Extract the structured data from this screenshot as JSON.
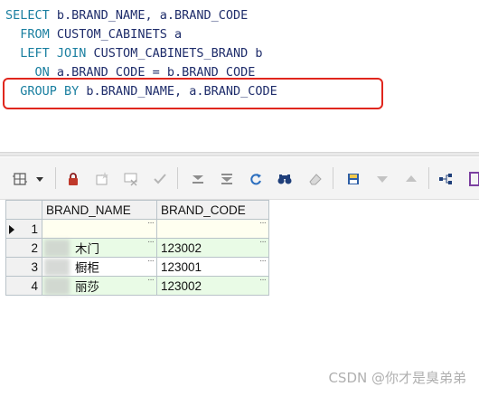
{
  "editor": {
    "lines": [
      {
        "kw1": "SELECT",
        "text": " b.BRAND_NAME, a.BRAND_CODE",
        "indent": ""
      },
      {
        "kw1": "FROM",
        "text": " CUSTOM_CABINETS a",
        "indent": "  "
      },
      {
        "kw1": "LEFT JOIN",
        "text": " CUSTOM_CABINETS_BRAND b",
        "indent": "  "
      },
      {
        "kw1": "ON",
        "text": " a.BRAND_CODE = b.BRAND_CODE",
        "indent": "    "
      },
      {
        "kw1": "GROUP BY",
        "text": " b.BRAND_NAME, a.BRAND_CODE",
        "indent": "  "
      }
    ]
  },
  "toolbar": {
    "icons": [
      "grid-options-icon",
      "dropdown-arrow-icon",
      "lock-icon",
      "new-record-icon",
      "delete-record-icon",
      "post-check-icon",
      "filter-first-icon",
      "filter-last-icon",
      "refresh-icon",
      "find-icon",
      "clear-icon",
      "save-icon",
      "sort-down-icon",
      "sort-up-icon",
      "tree-icon",
      "export-icon"
    ]
  },
  "grid": {
    "columns": [
      "BRAND_NAME",
      "BRAND_CODE"
    ],
    "rows": [
      {
        "num": "1",
        "brand_name": "",
        "brand_code": ""
      },
      {
        "num": "2",
        "brand_name": "木门",
        "brand_code": "123002"
      },
      {
        "num": "3",
        "brand_name": "橱柜",
        "brand_code": "123001"
      },
      {
        "num": "4",
        "brand_name": "丽莎",
        "brand_code": "123002"
      }
    ]
  },
  "watermark": "CSDN @你才是臭弟弟",
  "colors": {
    "keyword": "#1a7fa0",
    "identifier": "#1f2d6b",
    "highlight_border": "#e0261d",
    "modified_row": "#e9fbe6"
  }
}
